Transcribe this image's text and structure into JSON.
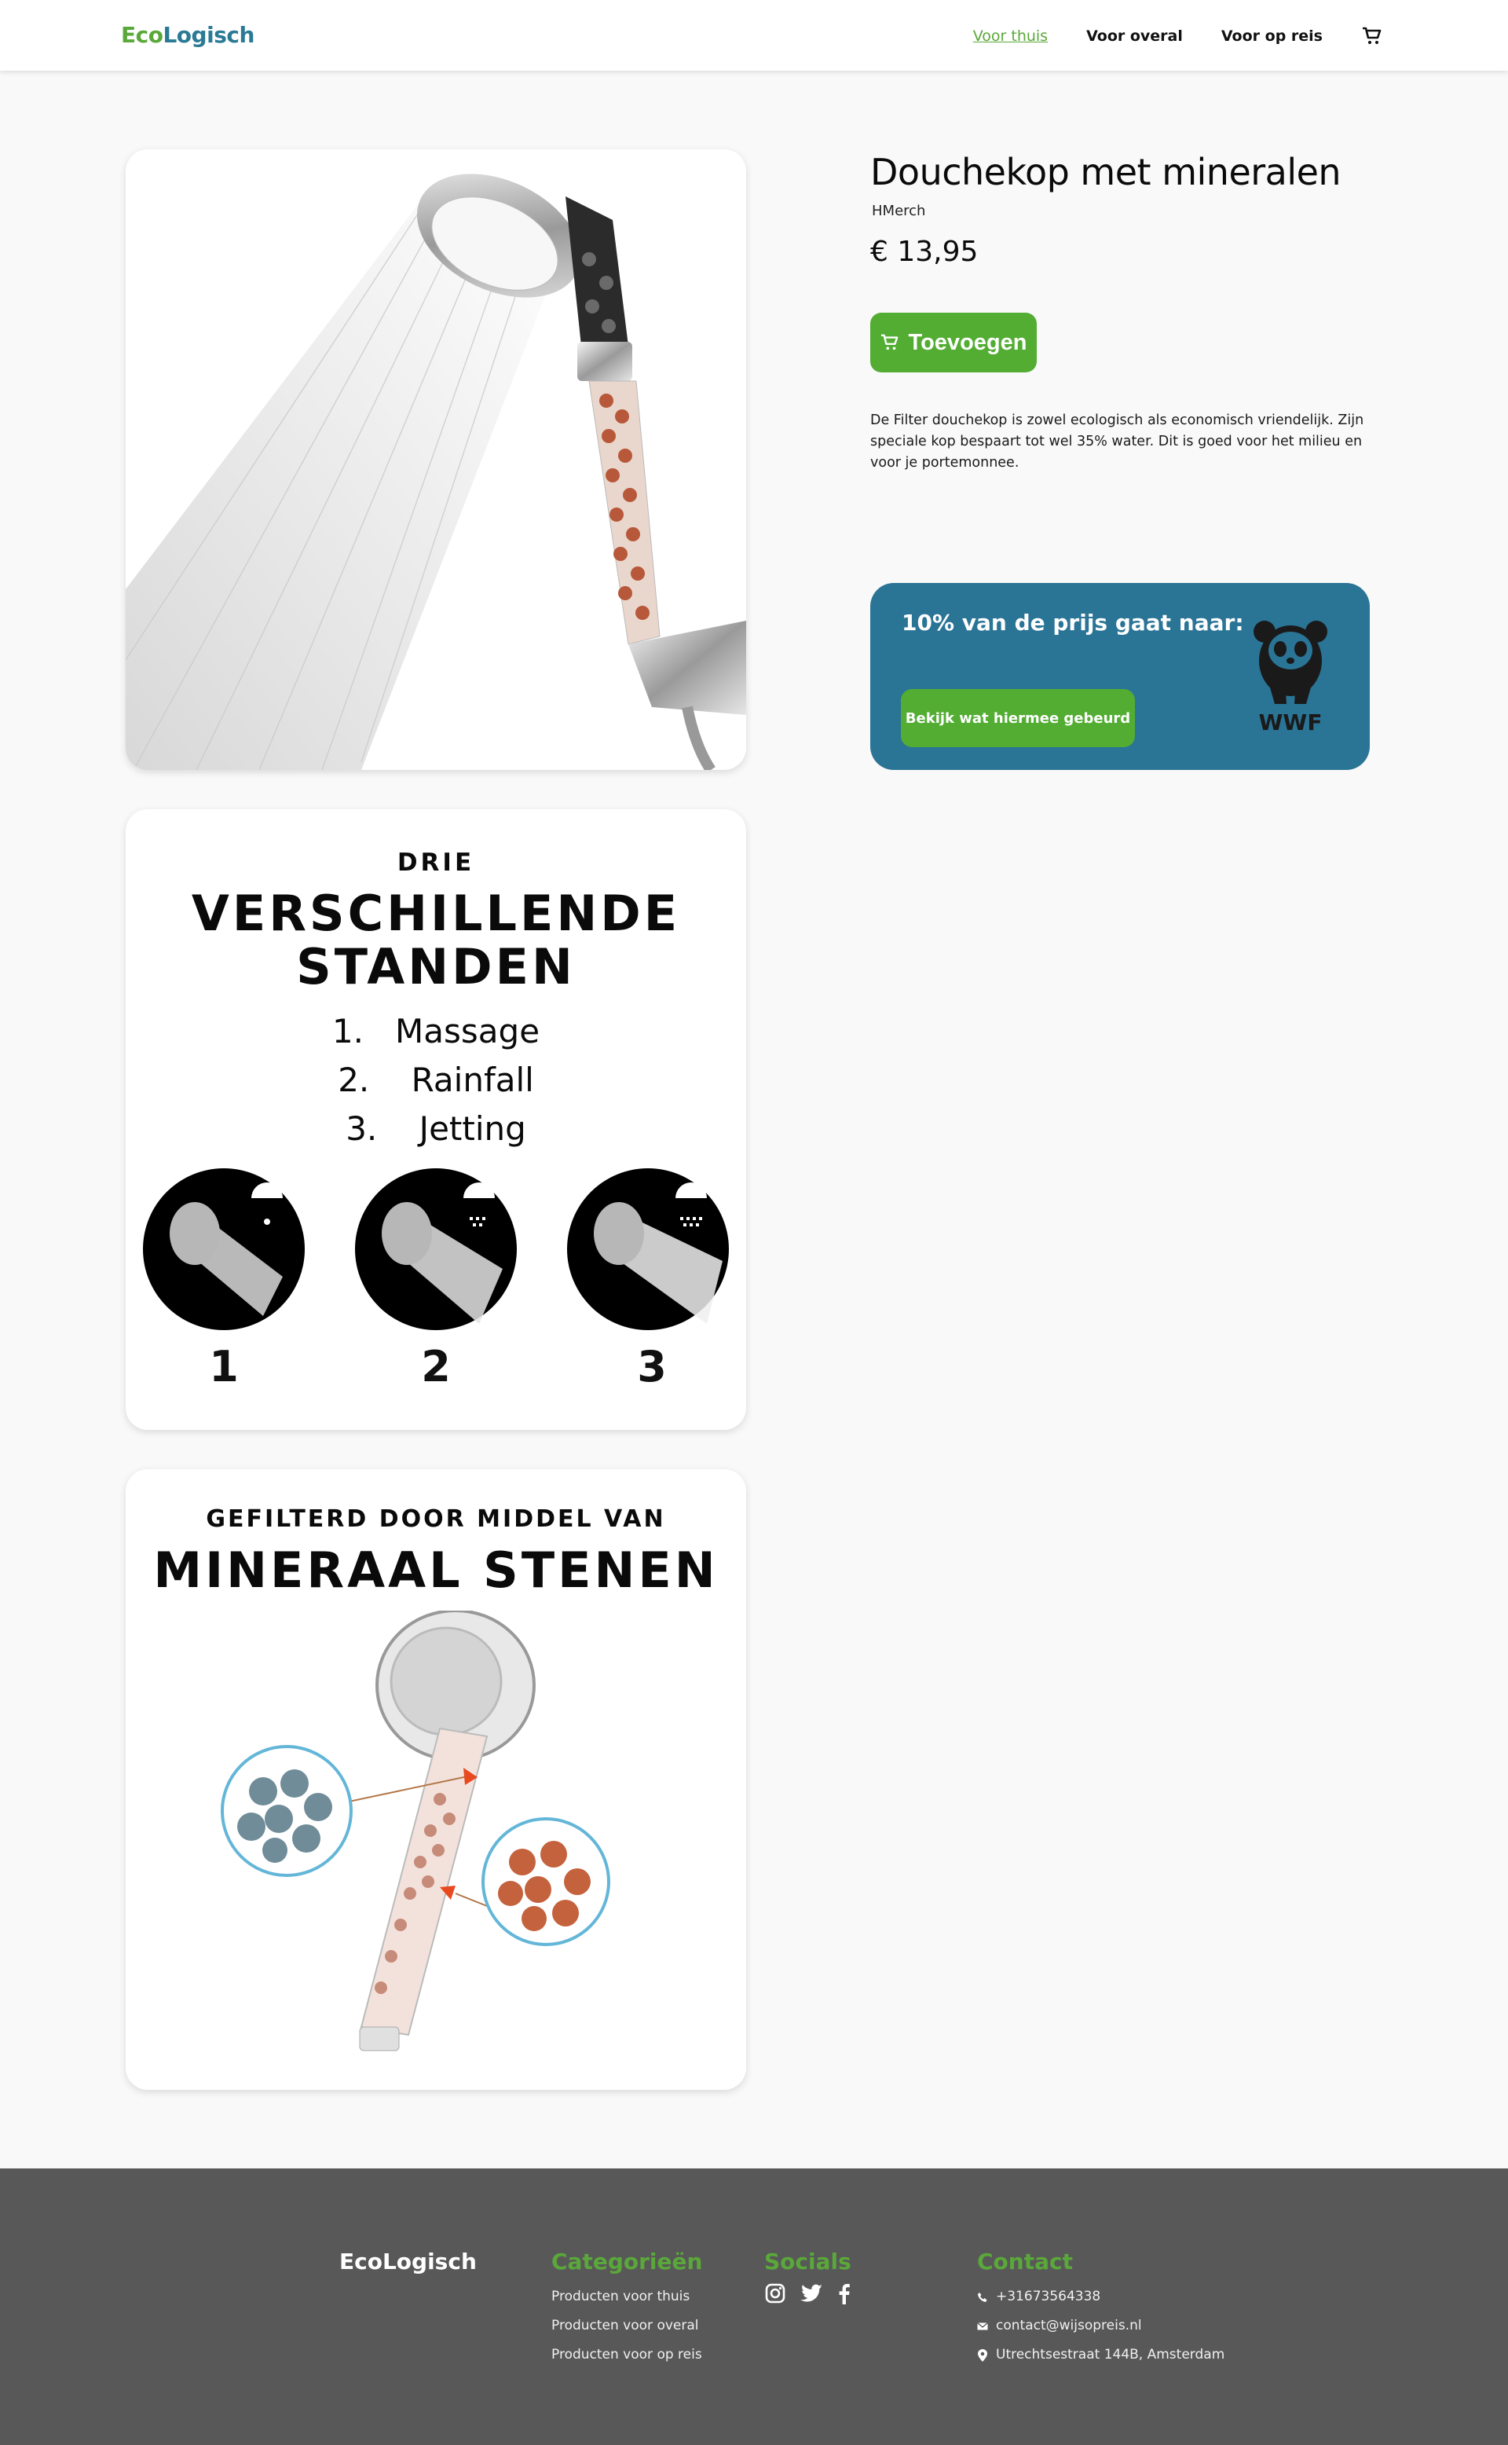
{
  "nav": {
    "logo_eco": "Eco",
    "logo_rest": "Logisch",
    "links": [
      "Voor thuis",
      "Voor overal",
      "Voor op reis"
    ],
    "active_link": "Voor thuis",
    "cart_icon": "shopping-cart-icon"
  },
  "product": {
    "title": "Douchekop met mineralen",
    "brand": "HMerch",
    "price": "€ 13,95",
    "add_button": "Toevoegen",
    "description": "De Filter douchekop is zowel ecologisch als economisch vriendelijk. Zijn speciale kop bespaart tot wel 35% water. Dit is goed voor het milieu en voor je portemonnee."
  },
  "images": {
    "image2": {
      "line1": "DRIE",
      "line2": "VERSCHILLENDE",
      "line3": "STANDEN",
      "modes": [
        "1.   Massage",
        "2.    Rainfall",
        "3.    Jetting"
      ],
      "numbers": [
        "1",
        "2",
        "3"
      ]
    },
    "image3": {
      "line1": "GEFILTERD DOOR MIDDEL VAN",
      "line2": "MINERAAL STENEN"
    }
  },
  "donation": {
    "text": "10% van de prijs gaat naar:",
    "button": "Bekijk wat hiermee gebeurd",
    "logo_text": "WWF"
  },
  "footer": {
    "brand": "EcoLogisch",
    "categories_title": "Categorieën",
    "categories": [
      "Producten voor thuis",
      "Producten voor overal",
      "Producten voor op reis"
    ],
    "socials_title": "Socials",
    "socials": [
      "instagram-icon",
      "twitter-icon",
      "facebook-icon"
    ],
    "contact_title": "Contact",
    "phone": "+31673564338",
    "email": "contact@wijsopreis.nl",
    "address": "Utrechtsestraat 144B, Amsterdam"
  },
  "colors": {
    "green": "#52ad32",
    "blue": "#2a7496",
    "footer": "#585858"
  }
}
